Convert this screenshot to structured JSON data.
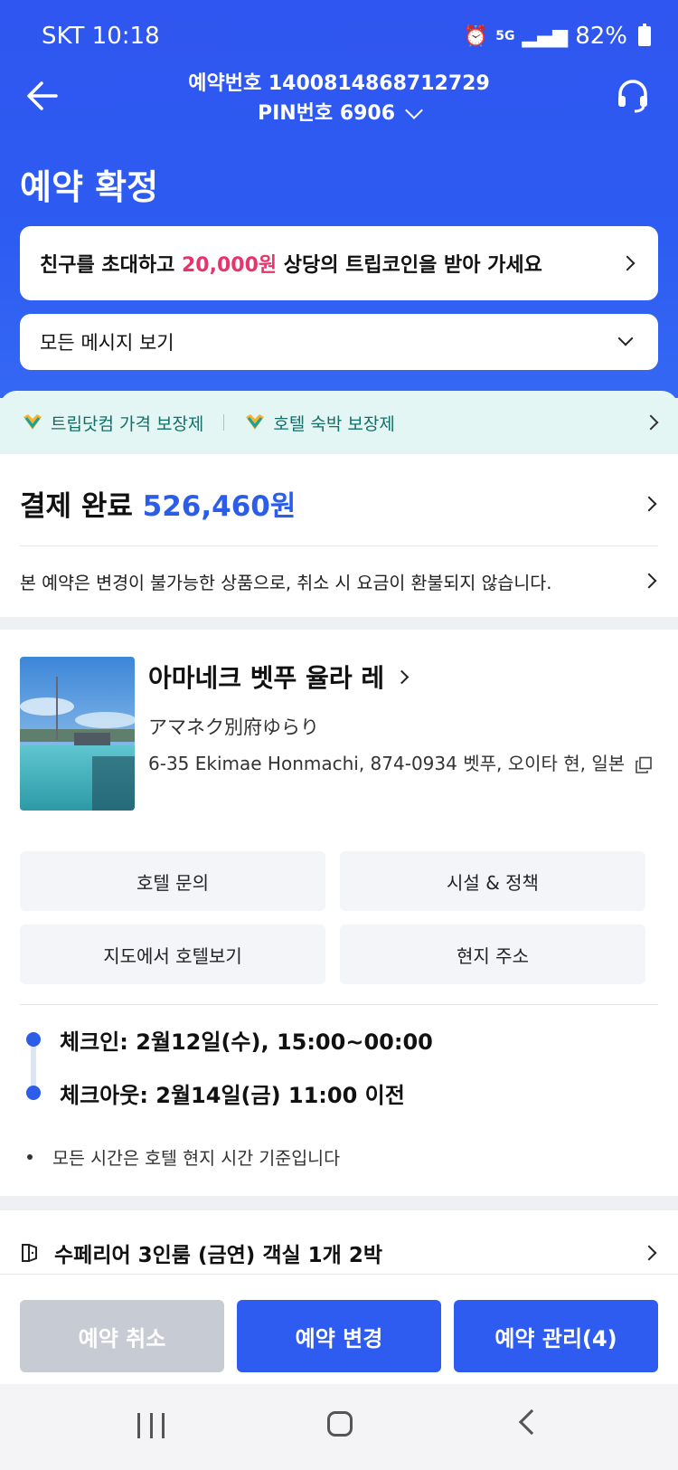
{
  "status": {
    "carrier_time": "SKT 10:18",
    "battery": "82%",
    "network": "5G"
  },
  "nav": {
    "booking_number": "예약번호 1400814868712729",
    "pin": "PIN번호 6906"
  },
  "title": "예약 확정",
  "promo": {
    "prefix": "친구를 초대하고 ",
    "highlight": "20,000원",
    "suffix": " 상당의 트립코인을 받아 가세요"
  },
  "messages": {
    "label": "모든 메시지 보기"
  },
  "guarantee": {
    "items": [
      "트립닷컴 가격 보장제",
      "호텔 숙박 보장제"
    ]
  },
  "payment": {
    "status": "결제 완료",
    "amount": "526,460원",
    "note": "본 예약은 변경이 불가능한 상품으로, 취소 시 요금이 환불되지 않습니다."
  },
  "hotel": {
    "name": "아마네크 벳푸 율라 레",
    "name_local": "アマネク別府ゆらり",
    "address": "6-35 Ekimae Honmachi, 874-0934 벳푸, 오이타 현, 일본",
    "buttons": [
      "호텔 문의",
      "시설 & 정책",
      "지도에서 호텔보기",
      "현지 주소"
    ],
    "checkin": "체크인: 2월12일(수), 15:00~00:00",
    "checkout": "체크아웃: 2월14일(금) 11:00 이전",
    "time_note": "모든 시간은 호텔 현지 시간 기준입니다"
  },
  "room": {
    "label": "수페리어 3인룸 (금연)  객실 1개 2박"
  },
  "actions": {
    "cancel": "예약 취소",
    "modify": "예약 변경",
    "manage": "예약 관리(4)"
  },
  "colors": {
    "brand_blue": "#2f56f0",
    "accent_pink": "#e8336c",
    "teal": "#126f68"
  }
}
